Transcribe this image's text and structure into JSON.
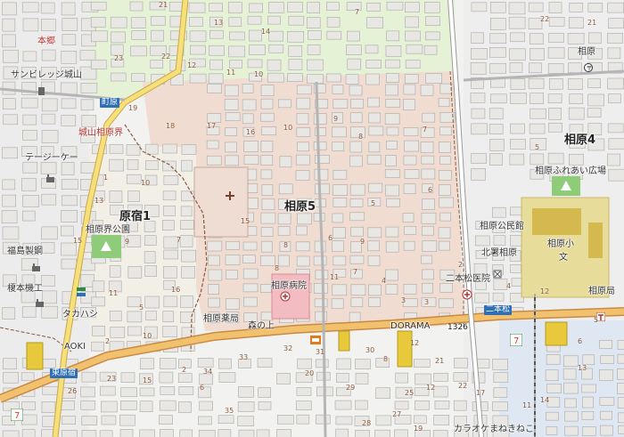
{
  "areas": [
    {
      "name": "相原5"
    },
    {
      "name": "原宿1"
    },
    {
      "name": "相原4"
    }
  ],
  "pois": [
    {
      "name": "サンビレッジ城山"
    },
    {
      "name": "テージーケー"
    },
    {
      "name": "福島製鋼"
    },
    {
      "name": "榎本機工"
    },
    {
      "name": "タカハシ"
    },
    {
      "name": "AOKI"
    },
    {
      "name": "相原界公園"
    },
    {
      "name": "相原病院"
    },
    {
      "name": "相原薬局"
    },
    {
      "name": "森の上"
    },
    {
      "name": "DORAMA"
    },
    {
      "name": "相原公民館"
    },
    {
      "name": "北署相原"
    },
    {
      "name": "相原小"
    },
    {
      "name": "相原ふれあい広場"
    },
    {
      "name": "二本松医院"
    },
    {
      "name": "相原局"
    },
    {
      "name": "カラオケまねきねこ"
    },
    {
      "name": "相原"
    },
    {
      "name": "文"
    }
  ],
  "red_labels": [
    {
      "name": "本郷"
    },
    {
      "name": "城山相原界"
    }
  ],
  "road_labels": [
    {
      "name": "町原"
    },
    {
      "name": "東原宿"
    },
    {
      "name": "二本松"
    },
    {
      "name": "1326"
    }
  ],
  "block_numbers": [
    "21",
    "13",
    "7",
    "14",
    "22",
    "21",
    "23",
    "22",
    "12",
    "11",
    "10",
    "9",
    "15",
    "8",
    "7",
    "19",
    "18",
    "17",
    "16",
    "10",
    "9",
    "8",
    "6",
    "7",
    "1",
    "13",
    "10",
    "9",
    "7",
    "15",
    "5",
    "3",
    "4",
    "11",
    "8",
    "11",
    "2",
    "6",
    "5",
    "4",
    "3",
    "2",
    "11",
    "8",
    "12",
    "16",
    "5",
    "10",
    "23",
    "26",
    "2",
    "6",
    "34",
    "33",
    "32",
    "31",
    "30",
    "29",
    "25",
    "21",
    "22",
    "35",
    "27",
    "28",
    "19",
    "20",
    "12",
    "17",
    "14",
    "13",
    "6",
    "5",
    "12",
    "15"
  ],
  "colors": {
    "residential_tint": "#f0dcd0",
    "building": "#e6e6e6",
    "building_border": "#b0b0b0",
    "main_road": "#f2c16e",
    "yellow_road": "#f7e07a",
    "park": "#8fcc7a",
    "school": "#e7dc9a",
    "hospital": "#f2bcc2",
    "boundary": "#8b5a3c"
  }
}
